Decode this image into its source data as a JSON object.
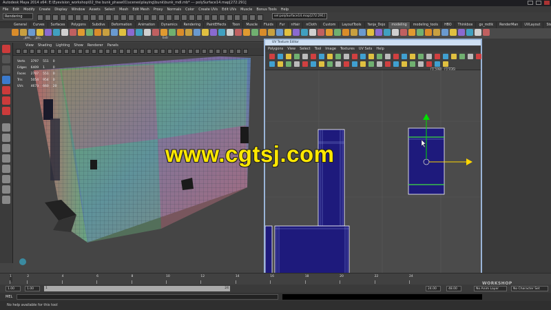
{
  "window": {
    "title": "Autodesk Maya 2014 x64: E:\\Eyevision_workshop\\02_the bunk_phase01\\scenes\\playing\\bunk\\bunk_mdl.mb*  ---  polySurface14.map[272:291]"
  },
  "menubar": {
    "items": [
      "File",
      "Edit",
      "Modify",
      "Create",
      "Display",
      "Window",
      "Assets",
      "Select",
      "Mesh",
      "Edit Mesh",
      "Proxy",
      "Normals",
      "Color",
      "Create UVs",
      "Edit UVs",
      "Muscle",
      "Bonus Tools",
      "Help"
    ]
  },
  "status_line": {
    "mode": "Rendering",
    "path_field": "sel:polySurface14.map[272:291]"
  },
  "shelf": {
    "tabs": [
      "General",
      "Curves",
      "Surfaces",
      "Polygons",
      "Subdivs",
      "Deformation",
      "Animation",
      "Dynamics",
      "Rendering",
      "PaintEffects",
      "Toon",
      "Muscle",
      "Fluids",
      "Fur",
      "nHair",
      "nCloth",
      "Custom",
      "LayoutTools",
      "Yanja_Dojo",
      "modeling",
      "modeling_tools",
      "HBO",
      "Thinkbox",
      "gx_mdtk",
      "RenderMan",
      "UVLayout",
      "Step_On_PREE"
    ],
    "active_tab": "modeling",
    "icon_labels": [
      "_geo_",
      "_grp_",
      "Extr"
    ]
  },
  "viewport": {
    "menu": [
      "View",
      "Shading",
      "Lighting",
      "Show",
      "Renderer",
      "Panels"
    ],
    "hud": [
      {
        "label": "Verts",
        "a": "3797",
        "b": "551",
        "c": "0"
      },
      {
        "label": "Edges",
        "a": "6409",
        "b": "1",
        "c": "0"
      },
      {
        "label": "Faces",
        "a": "2707",
        "b": "551",
        "c": "0"
      },
      {
        "label": "Tris",
        "a": "5054",
        "b": "954",
        "c": "0"
      },
      {
        "label": "UVs",
        "a": "4673",
        "b": "660",
        "c": "20"
      }
    ]
  },
  "uv_editor": {
    "title": "UV Texture Editor",
    "menu": [
      "Polygons",
      "View",
      "Select",
      "Tool",
      "Image",
      "Textures",
      "UV Sets",
      "Help"
    ],
    "field1": "0.598",
    "field2": "0.936"
  },
  "time_slider": {
    "ticks": [
      "1",
      "2",
      "4",
      "6",
      "8",
      "10",
      "12",
      "14",
      "16",
      "18",
      "20",
      "22",
      "24"
    ],
    "current": "1.00",
    "range_start": "1.00",
    "range_start2": "1",
    "range_end_inner": "24",
    "range_end": "24.00",
    "range_end2": "48.00",
    "anim_layer": "No Anim Layer",
    "character_set": "No Character Set"
  },
  "command_line": {
    "label": "MEL"
  },
  "help_line": {
    "text": "No help available for this tool"
  },
  "watermark": {
    "text": "www.cgtsj.com"
  },
  "logo": {
    "text": "WORKSHOP"
  },
  "colors": {
    "uv_shell": "#1e1a7c",
    "uv_wire": "#7e8ad6",
    "uv_border": "#ffffff",
    "selected_edge": "#40e040",
    "manip_y": "#00dd00",
    "manip_x": "#ffd700",
    "watermark": "#ffe800"
  }
}
